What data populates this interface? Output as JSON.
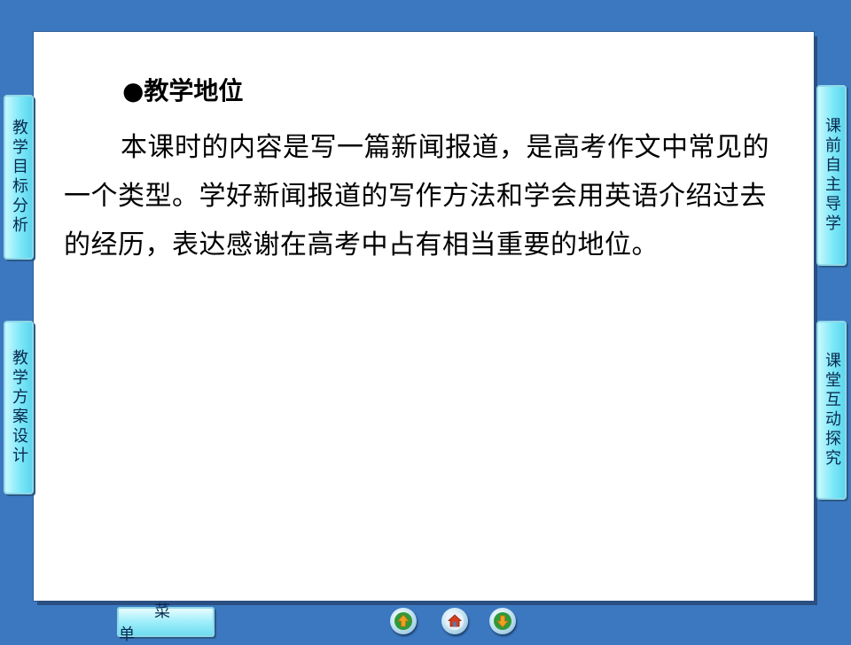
{
  "slide": {
    "heading": "●教学地位",
    "paragraph": "本课时的内容是写一篇新闻报道，是高考作文中常见的一个类型。学好新闻报道的写作方法和学会用英语介绍过去的经历，表达感谢在高考中占有相当重要的地位。"
  },
  "left_tabs": [
    {
      "label": "教学目标分析"
    },
    {
      "label": "教学方案设计"
    }
  ],
  "right_tabs": [
    {
      "label": "课前自主导学"
    },
    {
      "label": "课堂互动探究"
    }
  ],
  "bottom_bar": {
    "menu_label": "菜单"
  },
  "colors": {
    "background": "#3c78c0",
    "tab_fill": "#7ee8f8",
    "nav_arrow": "#f0a020",
    "nav_home": "#d04020"
  },
  "icons": {
    "prev": "up-arrow-icon",
    "home": "home-icon",
    "next": "down-arrow-icon"
  }
}
